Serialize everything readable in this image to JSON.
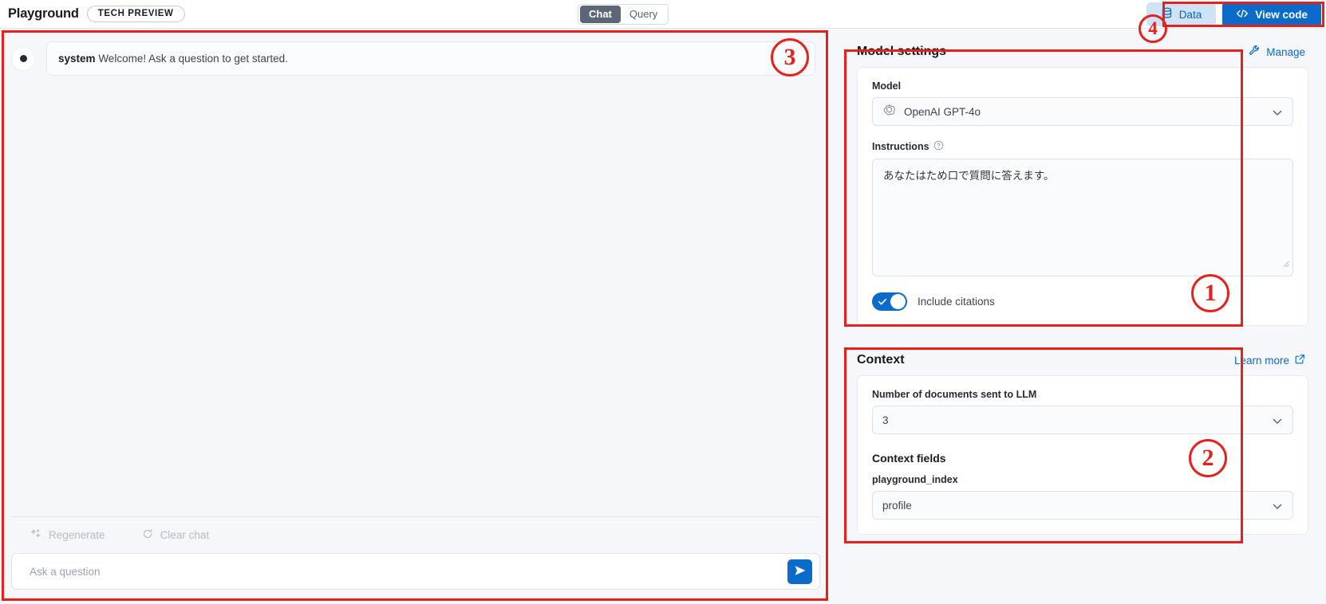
{
  "topbar": {
    "brand": "Playground",
    "badge": "TECH PREVIEW",
    "modes": [
      {
        "label": "Chat",
        "active": true
      },
      {
        "label": "Query",
        "active": false
      }
    ],
    "data_button": "Data",
    "view_code_button": "View code",
    "icons": {
      "database": "database-icon",
      "code": "code-brackets-icon"
    }
  },
  "chat": {
    "message": {
      "role": "system",
      "text": "Welcome! Ask a question to get started."
    },
    "actions": [
      {
        "label": "Regenerate",
        "icon": "sparkle-icon"
      },
      {
        "label": "Clear chat",
        "icon": "refresh-icon"
      }
    ],
    "composer": {
      "placeholder": "Ask a question",
      "value": "",
      "send_icon": "send-paper-plane-icon"
    }
  },
  "model_settings": {
    "title": "Model settings",
    "manage_label": "Manage",
    "manage_icon": "wrench-icon",
    "model_label": "Model",
    "model_value": "OpenAI GPT-4o",
    "model_icon": "openai-logo-icon",
    "instructions_label": "Instructions",
    "instructions_help_icon": "help-circle-icon",
    "instructions_value": "あなたはため口で質問に答えます。",
    "include_citations_label": "Include citations",
    "include_citations_on": true
  },
  "context": {
    "title": "Context",
    "learn_more_label": "Learn more",
    "learn_more_icon": "external-link-icon",
    "num_docs_label": "Number of documents sent to LLM",
    "num_docs_value": "3",
    "context_fields_title": "Context fields",
    "field_name": "playground_index",
    "field_value": "profile"
  },
  "annotations": {
    "markers": [
      "1",
      "2",
      "3",
      "4"
    ]
  },
  "colors": {
    "accent_blue": "#0b6bcb",
    "data_button_bg": "#cfe3f7",
    "annotation_red": "#e8201c",
    "page_bg": "#f5f7fa",
    "mode_active_bg": "#5d6676"
  }
}
